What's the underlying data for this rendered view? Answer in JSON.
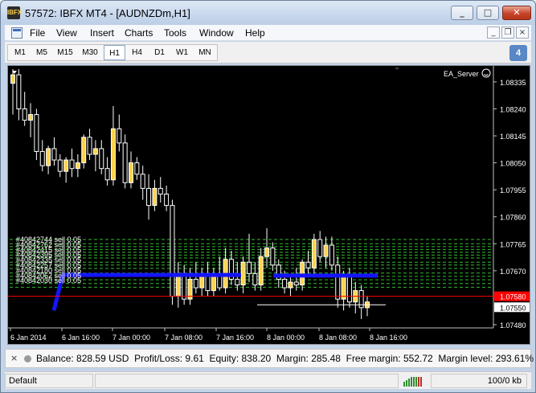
{
  "window": {
    "title": "57572: IBFX MT4 - [AUDNZDm,H1]",
    "app_icon_text": "IBFX"
  },
  "menu": [
    "File",
    "View",
    "Insert",
    "Charts",
    "Tools",
    "Window",
    "Help"
  ],
  "mdi_controls": [
    "_",
    "❐",
    "×"
  ],
  "timeframes": [
    "M1",
    "M5",
    "M15",
    "M30",
    "H1",
    "H4",
    "D1",
    "W1",
    "MN"
  ],
  "active_timeframe": "H1",
  "toolbar_badge": "4",
  "chart": {
    "symbol_period": "AUDNZDm,H1",
    "expert_label": "EA_Server",
    "price_scale": [
      "1.08335",
      "1.08240",
      "1.08145",
      "1.08050",
      "1.07955",
      "1.07860",
      "1.07765",
      "1.07670",
      "1.07580",
      "1.07550",
      "1.07480"
    ],
    "highlight_prices": {
      "red": "1.07580",
      "white": "1.07550"
    },
    "time_labels": [
      "6 Jan 2014",
      "6 Jan 16:00",
      "7 Jan 00:00",
      "7 Jan 08:00",
      "7 Jan 16:00",
      "8 Jan 00:00",
      "8 Jan 08:00",
      "8 Jan 16:00"
    ],
    "order_labels": [
      "#40842744 sell 0.05",
      "#40842762 sell 0.05",
      "#40842415 sell 0.05",
      "#40842395 sell 0.05",
      "#40842335 sell 0.05",
      "#40842257 sell 0.05",
      "#40842180 sell 0.05",
      "#40842062 sell 0.05",
      "#40842030 sell 0.05"
    ],
    "colors": {
      "bull": "#ffd24a",
      "bear": "#000000",
      "wick": "#ffffff",
      "order_line": "#2fbf2f",
      "trend": "#1414ff",
      "bid": "#ff0000",
      "background": "#000000"
    }
  },
  "chart_data": {
    "type": "candlestick",
    "y_range": [
      1.0748,
      1.0838
    ],
    "candles": [
      {
        "o": 1.0833,
        "h": 1.0838,
        "l": 1.0822,
        "c": 1.0836
      },
      {
        "o": 1.0836,
        "h": 1.0838,
        "l": 1.082,
        "c": 1.0824
      },
      {
        "o": 1.0824,
        "h": 1.083,
        "l": 1.0818,
        "c": 1.082
      },
      {
        "o": 1.082,
        "h": 1.0826,
        "l": 1.0814,
        "c": 1.0822
      },
      {
        "o": 1.0822,
        "h": 1.0824,
        "l": 1.0806,
        "c": 1.0809
      },
      {
        "o": 1.0809,
        "h": 1.0813,
        "l": 1.0802,
        "c": 1.0804
      },
      {
        "o": 1.0804,
        "h": 1.0811,
        "l": 1.0801,
        "c": 1.081
      },
      {
        "o": 1.081,
        "h": 1.0814,
        "l": 1.0804,
        "c": 1.0806
      },
      {
        "o": 1.0806,
        "h": 1.0808,
        "l": 1.08,
        "c": 1.0802
      },
      {
        "o": 1.0802,
        "h": 1.0807,
        "l": 1.0798,
        "c": 1.0806
      },
      {
        "o": 1.0806,
        "h": 1.081,
        "l": 1.08,
        "c": 1.0803
      },
      {
        "o": 1.0803,
        "h": 1.0808,
        "l": 1.08,
        "c": 1.0805
      },
      {
        "o": 1.0805,
        "h": 1.0815,
        "l": 1.0803,
        "c": 1.0814
      },
      {
        "o": 1.0814,
        "h": 1.0817,
        "l": 1.0806,
        "c": 1.0808
      },
      {
        "o": 1.0808,
        "h": 1.0813,
        "l": 1.0802,
        "c": 1.081
      },
      {
        "o": 1.081,
        "h": 1.0813,
        "l": 1.0801,
        "c": 1.0803
      },
      {
        "o": 1.0803,
        "h": 1.0807,
        "l": 1.0797,
        "c": 1.0799
      },
      {
        "o": 1.0799,
        "h": 1.0825,
        "l": 1.0797,
        "c": 1.0817
      },
      {
        "o": 1.0817,
        "h": 1.0822,
        "l": 1.0809,
        "c": 1.0812
      },
      {
        "o": 1.0812,
        "h": 1.0815,
        "l": 1.0796,
        "c": 1.0798
      },
      {
        "o": 1.0798,
        "h": 1.0809,
        "l": 1.0796,
        "c": 1.0805
      },
      {
        "o": 1.0805,
        "h": 1.0807,
        "l": 1.0799,
        "c": 1.0801
      },
      {
        "o": 1.0801,
        "h": 1.0804,
        "l": 1.0792,
        "c": 1.0796
      },
      {
        "o": 1.0796,
        "h": 1.0801,
        "l": 1.0785,
        "c": 1.079
      },
      {
        "o": 1.079,
        "h": 1.0799,
        "l": 1.0788,
        "c": 1.0796
      },
      {
        "o": 1.0796,
        "h": 1.08,
        "l": 1.0791,
        "c": 1.0794
      },
      {
        "o": 1.0794,
        "h": 1.0797,
        "l": 1.0788,
        "c": 1.079
      },
      {
        "o": 1.079,
        "h": 1.0792,
        "l": 1.0755,
        "c": 1.0758
      },
      {
        "o": 1.0758,
        "h": 1.077,
        "l": 1.0754,
        "c": 1.0766
      },
      {
        "o": 1.0766,
        "h": 1.0769,
        "l": 1.0755,
        "c": 1.0757
      },
      {
        "o": 1.0757,
        "h": 1.0768,
        "l": 1.0755,
        "c": 1.0764
      },
      {
        "o": 1.0764,
        "h": 1.077,
        "l": 1.0759,
        "c": 1.0761
      },
      {
        "o": 1.0761,
        "h": 1.0768,
        "l": 1.0758,
        "c": 1.0766
      },
      {
        "o": 1.0766,
        "h": 1.077,
        "l": 1.0758,
        "c": 1.076
      },
      {
        "o": 1.076,
        "h": 1.0768,
        "l": 1.0758,
        "c": 1.0766
      },
      {
        "o": 1.0766,
        "h": 1.0772,
        "l": 1.076,
        "c": 1.0761
      },
      {
        "o": 1.0761,
        "h": 1.0775,
        "l": 1.0759,
        "c": 1.0771
      },
      {
        "o": 1.0771,
        "h": 1.0774,
        "l": 1.0762,
        "c": 1.0764
      },
      {
        "o": 1.0764,
        "h": 1.077,
        "l": 1.076,
        "c": 1.0762
      },
      {
        "o": 1.0762,
        "h": 1.0772,
        "l": 1.0759,
        "c": 1.077
      },
      {
        "o": 1.077,
        "h": 1.078,
        "l": 1.0763,
        "c": 1.0766
      },
      {
        "o": 1.0766,
        "h": 1.077,
        "l": 1.076,
        "c": 1.0762
      },
      {
        "o": 1.0762,
        "h": 1.0775,
        "l": 1.076,
        "c": 1.0772
      },
      {
        "o": 1.0772,
        "h": 1.0782,
        "l": 1.0768,
        "c": 1.0775
      },
      {
        "o": 1.0775,
        "h": 1.0777,
        "l": 1.0767,
        "c": 1.0769
      },
      {
        "o": 1.0769,
        "h": 1.0771,
        "l": 1.0761,
        "c": 1.0764
      },
      {
        "o": 1.0764,
        "h": 1.0767,
        "l": 1.0759,
        "c": 1.0761
      },
      {
        "o": 1.0761,
        "h": 1.0765,
        "l": 1.0758,
        "c": 1.0763
      },
      {
        "o": 1.0763,
        "h": 1.0768,
        "l": 1.076,
        "c": 1.0762
      },
      {
        "o": 1.0762,
        "h": 1.0771,
        "l": 1.076,
        "c": 1.077
      },
      {
        "o": 1.077,
        "h": 1.0774,
        "l": 1.0766,
        "c": 1.0768
      },
      {
        "o": 1.0768,
        "h": 1.078,
        "l": 1.0766,
        "c": 1.0778
      },
      {
        "o": 1.0778,
        "h": 1.0781,
        "l": 1.077,
        "c": 1.0772
      },
      {
        "o": 1.0772,
        "h": 1.0779,
        "l": 1.0768,
        "c": 1.0776
      },
      {
        "o": 1.0776,
        "h": 1.0779,
        "l": 1.0767,
        "c": 1.0769
      },
      {
        "o": 1.0769,
        "h": 1.0772,
        "l": 1.0754,
        "c": 1.0757
      },
      {
        "o": 1.0757,
        "h": 1.0767,
        "l": 1.0753,
        "c": 1.0765
      },
      {
        "o": 1.0765,
        "h": 1.0768,
        "l": 1.0754,
        "c": 1.0756
      },
      {
        "o": 1.0756,
        "h": 1.0763,
        "l": 1.0752,
        "c": 1.076
      },
      {
        "o": 1.076,
        "h": 1.0762,
        "l": 1.075,
        "c": 1.0754
      },
      {
        "o": 1.0754,
        "h": 1.0758,
        "l": 1.0751,
        "c": 1.0756
      }
    ]
  },
  "account": {
    "balance": "Balance: 828.59 USD",
    "profit": "Profit/Loss: 9.61",
    "equity": "Equity: 838.20",
    "margin": "Margin: 285.48",
    "free_margin": "Free margin: 552.72",
    "margin_level": "Margin level: 293.61%"
  },
  "status": {
    "profile": "Default",
    "traffic": "100/0 kb"
  }
}
